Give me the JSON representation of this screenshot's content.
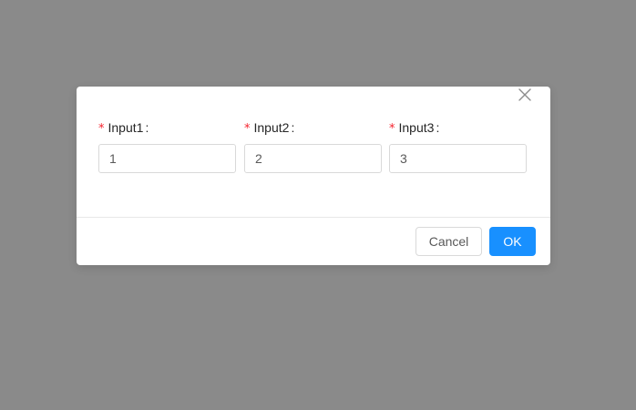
{
  "dialog": {
    "close_icon": "close-icon",
    "fields": [
      {
        "required_mark": "*",
        "label": "Input1",
        "colon": ":",
        "value": "1"
      },
      {
        "required_mark": "*",
        "label": "Input2",
        "colon": ":",
        "value": "2"
      },
      {
        "required_mark": "*",
        "label": "Input3",
        "colon": ":",
        "value": "3"
      }
    ],
    "footer": {
      "cancel_label": "Cancel",
      "ok_label": "OK"
    }
  },
  "colors": {
    "overlay": "#8a8a8a",
    "primary": "#1890ff",
    "required": "#f5222d"
  }
}
